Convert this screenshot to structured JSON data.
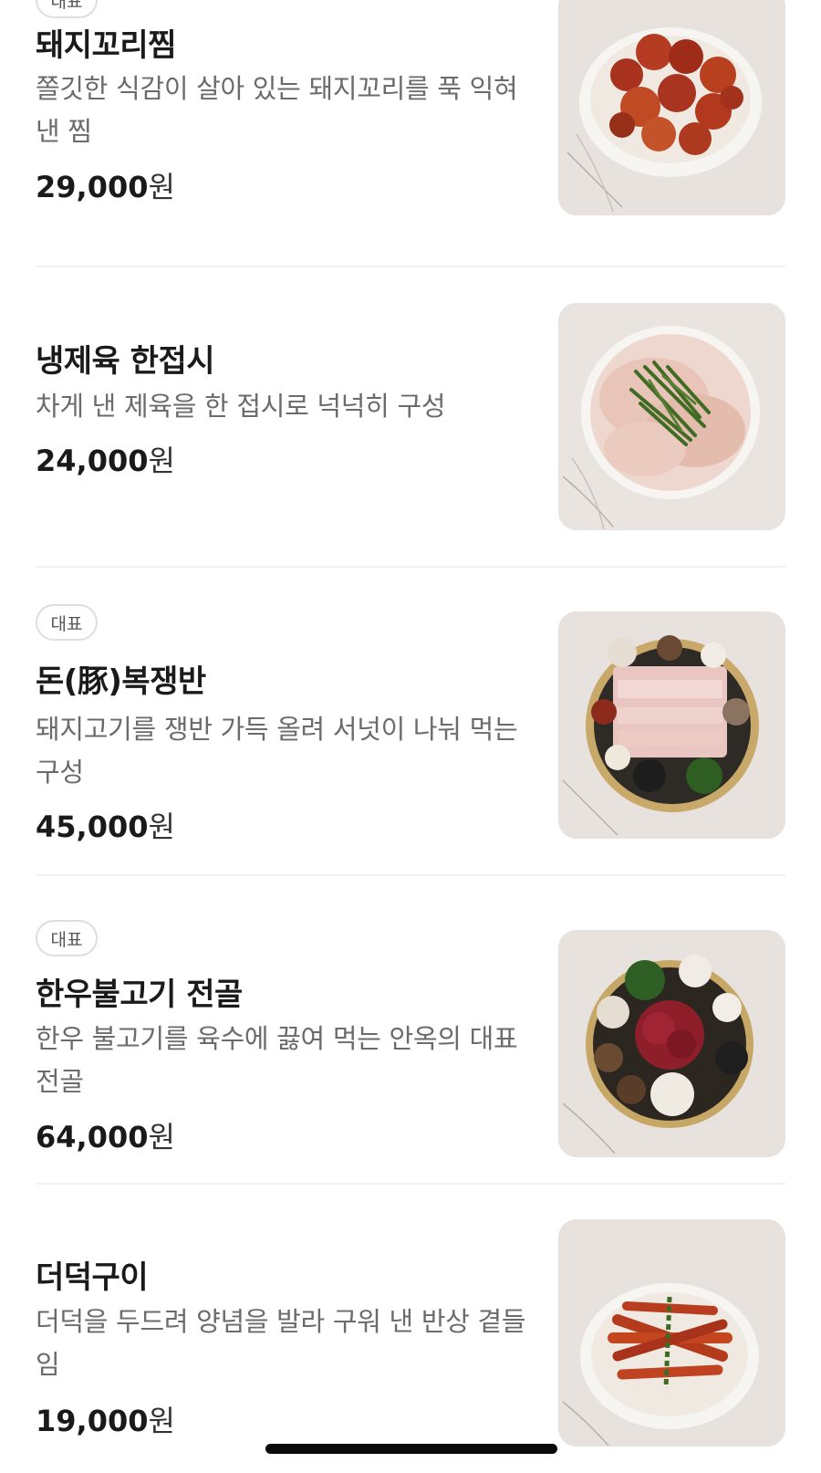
{
  "menu_items": [
    {
      "badge": "대표",
      "name": "돼지꼬리찜",
      "description": "쫄깃한 식감이 살아 있는 돼지꼬리를 푹 익혀 낸 찜",
      "price_number": "29,000",
      "price_unit": "원",
      "image": "braised-pork-tail-photo"
    },
    {
      "badge": "",
      "name": "냉제육 한접시",
      "description": "차게 낸 제육을 한 접시로 넉넉히 구성",
      "price_number": "24,000",
      "price_unit": "원",
      "image": "cold-pressed-pork-photo"
    },
    {
      "badge": "대표",
      "name": "돈(豚)복쟁반",
      "description": "돼지고기를 쟁반 가득 올려 서넛이 나눠 먹는 구성",
      "price_number": "45,000",
      "price_unit": "원",
      "image": "pork-platter-hotpot-photo"
    },
    {
      "badge": "대표",
      "name": "한우불고기 전골",
      "description": "한우 불고기를 육수에 끓여 먹는 안옥의 대표 전골",
      "price_number": "64,000",
      "price_unit": "원",
      "image": "hanwoo-bulgogi-hotpot-photo"
    },
    {
      "badge": "",
      "name": "더덕구이",
      "description": "더덕을 두드려 양념을 발라 구워 낸 반상 곁들임",
      "price_number": "19,000",
      "price_unit": "원",
      "image": "grilled-deodeok-photo"
    }
  ],
  "colors": {
    "text_primary": "#1a1a1a",
    "text_secondary": "#6b6b6b",
    "badge_border": "#dedede",
    "divider": "#f1f1f1",
    "photo_background": "#e7e2dd"
  },
  "icons": {
    "home_indicator": "home-indicator-bar"
  }
}
